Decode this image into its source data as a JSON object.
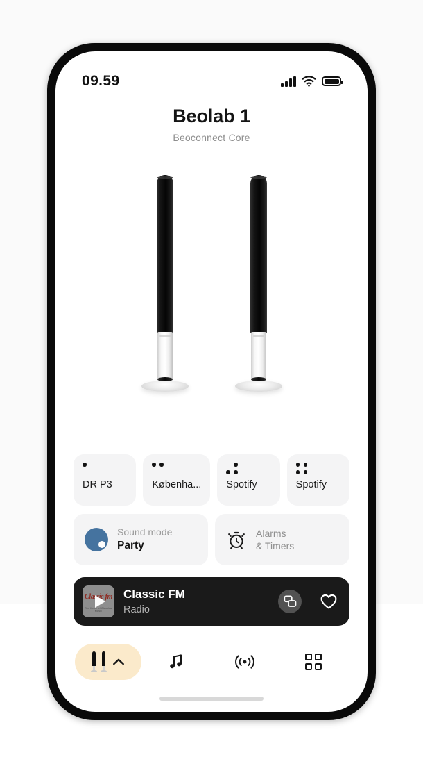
{
  "statusbar": {
    "time": "09.59",
    "signal_icon": "cellular-bars-icon",
    "wifi_icon": "wifi-icon",
    "battery_icon": "battery-full-icon"
  },
  "header": {
    "title": "Beolab 1",
    "subtitle": "Beoconnect Core"
  },
  "device_art": {
    "name": "beolab-speakers-illustration",
    "count": 2
  },
  "presets": [
    {
      "label": "DR P3",
      "dots": 1,
      "icon": "preset-one-dot-icon"
    },
    {
      "label": "Københa...",
      "dots": 2,
      "icon": "preset-two-dots-icon"
    },
    {
      "label": "Spotify",
      "dots": 3,
      "icon": "preset-three-dots-icon"
    },
    {
      "label": "Spotify",
      "dots": 4,
      "icon": "preset-four-dots-icon"
    }
  ],
  "cards": {
    "sound_mode": {
      "label": "Sound mode",
      "value": "Party",
      "icon": "sound-mode-circle-icon",
      "icon_color": "#45739f"
    },
    "alarms": {
      "line1": "Alarms",
      "line2": "& Timers",
      "icon": "alarm-clock-icon"
    }
  },
  "now_playing": {
    "title": "Classic FM",
    "subtitle": "Radio",
    "art_logo": "Classic fm",
    "art_tagline": "The Home of Classical Music",
    "art_icon": "play-triangle-icon",
    "multiroom_icon": "multiroom-overlap-icon",
    "favorite_icon": "heart-outline-icon",
    "background_color": "#1a1a1a"
  },
  "bottom_nav": {
    "active_pill": {
      "icon": "speakers-pill-icon",
      "chevron": "chevron-up-icon",
      "background_color": "#fbeacb"
    },
    "items": [
      {
        "icon": "music-note-icon",
        "active": false
      },
      {
        "icon": "broadcast-waves-icon",
        "active": false
      },
      {
        "icon": "grid-squares-icon",
        "active": false
      }
    ],
    "home_indicator": "home-indicator-bar"
  }
}
